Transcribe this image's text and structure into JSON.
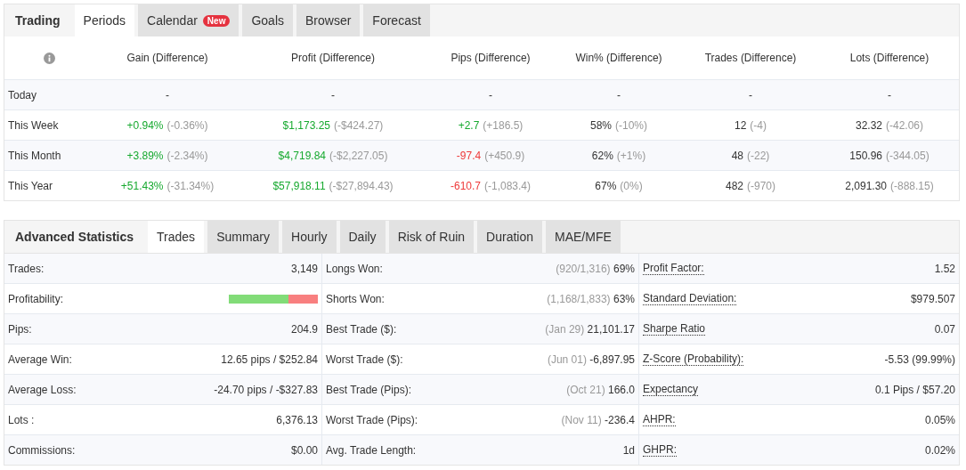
{
  "periods_panel": {
    "title": "Trading",
    "tabs": [
      {
        "label": "Periods",
        "selected": true
      },
      {
        "label": "Calendar",
        "selected": false,
        "badge": "New"
      },
      {
        "label": "Goals",
        "selected": false
      },
      {
        "label": "Browser",
        "selected": false
      },
      {
        "label": "Forecast",
        "selected": false
      }
    ],
    "table": {
      "columns": [
        "Gain (Difference)",
        "Profit (Difference)",
        "Pips (Difference)",
        "Win% (Difference)",
        "Trades (Difference)",
        "Lots (Difference)"
      ],
      "rows": [
        {
          "period": "Today",
          "cells": [
            {
              "value": "-"
            },
            {
              "value": "-"
            },
            {
              "value": "-"
            },
            {
              "value": "-"
            },
            {
              "value": "-"
            },
            {
              "value": "-"
            }
          ]
        },
        {
          "period": "This Week",
          "cells": [
            {
              "value": "+0.94%",
              "diff": "(-0.36%)",
              "color": "#17a92f"
            },
            {
              "value": "$1,173.25",
              "diff": "(-$424.27)",
              "color": "#17a92f"
            },
            {
              "value": "+2.7",
              "diff": "(+186.5)",
              "color": "#17a92f"
            },
            {
              "value": "58%",
              "diff": "(-10%)",
              "color": "#333333"
            },
            {
              "value": "12",
              "diff": "(-4)",
              "color": "#333333"
            },
            {
              "value": "32.32",
              "diff": "(-42.06)",
              "color": "#333333"
            }
          ]
        },
        {
          "period": "This Month",
          "cells": [
            {
              "value": "+3.89%",
              "diff": "(-2.34%)",
              "color": "#17a92f"
            },
            {
              "value": "$4,719.84",
              "diff": "(-$2,227.05)",
              "color": "#17a92f"
            },
            {
              "value": "-97.4",
              "diff": "(+450.9)",
              "color": "#ee3a3a"
            },
            {
              "value": "62%",
              "diff": "(+1%)",
              "color": "#333333"
            },
            {
              "value": "48",
              "diff": "(-22)",
              "color": "#333333"
            },
            {
              "value": "150.96",
              "diff": "(-344.05)",
              "color": "#333333"
            }
          ]
        },
        {
          "period": "This Year",
          "cells": [
            {
              "value": "+51.43%",
              "diff": "(-31.34%)",
              "color": "#17a92f"
            },
            {
              "value": "$57,918.11",
              "diff": "(-$27,894.43)",
              "color": "#17a92f"
            },
            {
              "value": "-610.7",
              "diff": "(-1,083.4)",
              "color": "#ee3a3a"
            },
            {
              "value": "67%",
              "diff": "(0%)",
              "color": "#333333"
            },
            {
              "value": "482",
              "diff": "(-970)",
              "color": "#333333"
            },
            {
              "value": "2,091.30",
              "diff": "(-888.15)",
              "color": "#333333"
            }
          ]
        }
      ]
    }
  },
  "stats_panel": {
    "title": "Advanced Statistics",
    "tabs": [
      {
        "label": "Trades",
        "selected": true
      },
      {
        "label": "Summary",
        "selected": false
      },
      {
        "label": "Hourly",
        "selected": false
      },
      {
        "label": "Daily",
        "selected": false
      },
      {
        "label": "Risk of Ruin",
        "selected": false
      },
      {
        "label": "Duration",
        "selected": false
      },
      {
        "label": "MAE/MFE",
        "selected": false
      }
    ],
    "columns": [
      {
        "dotted": false,
        "items": [
          {
            "label": "Trades:",
            "value": "3,149"
          },
          {
            "label": "Profitability:",
            "kind": "bar",
            "level": 0.67
          },
          {
            "label": "Pips:",
            "value": "204.9"
          },
          {
            "label": "Average Win:",
            "value": "12.65 pips / $252.84"
          },
          {
            "label": "Average Loss:",
            "value": "-24.70 pips / -$327.83"
          },
          {
            "label": "Lots :",
            "value": "6,376.13"
          },
          {
            "label": "Commissions:",
            "value": "$0.00"
          }
        ]
      },
      {
        "dotted": false,
        "items": [
          {
            "label": "Longs Won:",
            "note": "(920/1,316)",
            "value": "69%"
          },
          {
            "label": "Shorts Won:",
            "note": "(1,168/1,833)",
            "value": "63%"
          },
          {
            "label": "Best Trade ($):",
            "note": "(Jan 29)",
            "value": "21,101.17"
          },
          {
            "label": "Worst Trade ($):",
            "note": "(Jun 01)",
            "value": "-6,897.95"
          },
          {
            "label": "Best Trade (Pips):",
            "note": "(Oct 21)",
            "value": "166.0"
          },
          {
            "label": "Worst Trade (Pips):",
            "note": "(Nov 11)",
            "value": "-236.4"
          },
          {
            "label": "Avg. Trade Length:",
            "value": "1d"
          }
        ]
      },
      {
        "dotted": true,
        "items": [
          {
            "label": "Profit Factor:",
            "value": "1.52"
          },
          {
            "label": "Standard Deviation:",
            "value": "$979.507"
          },
          {
            "label": "Sharpe Ratio",
            "value": "0.07"
          },
          {
            "label": "Z-Score (Probability):",
            "value": "-5.53 (99.99%)"
          },
          {
            "label": "Expectancy",
            "value": "0.1 Pips / $57.20"
          },
          {
            "label": "AHPR:",
            "value": "0.05%"
          },
          {
            "label": "GHPR:",
            "value": "0.02%"
          }
        ]
      }
    ]
  }
}
